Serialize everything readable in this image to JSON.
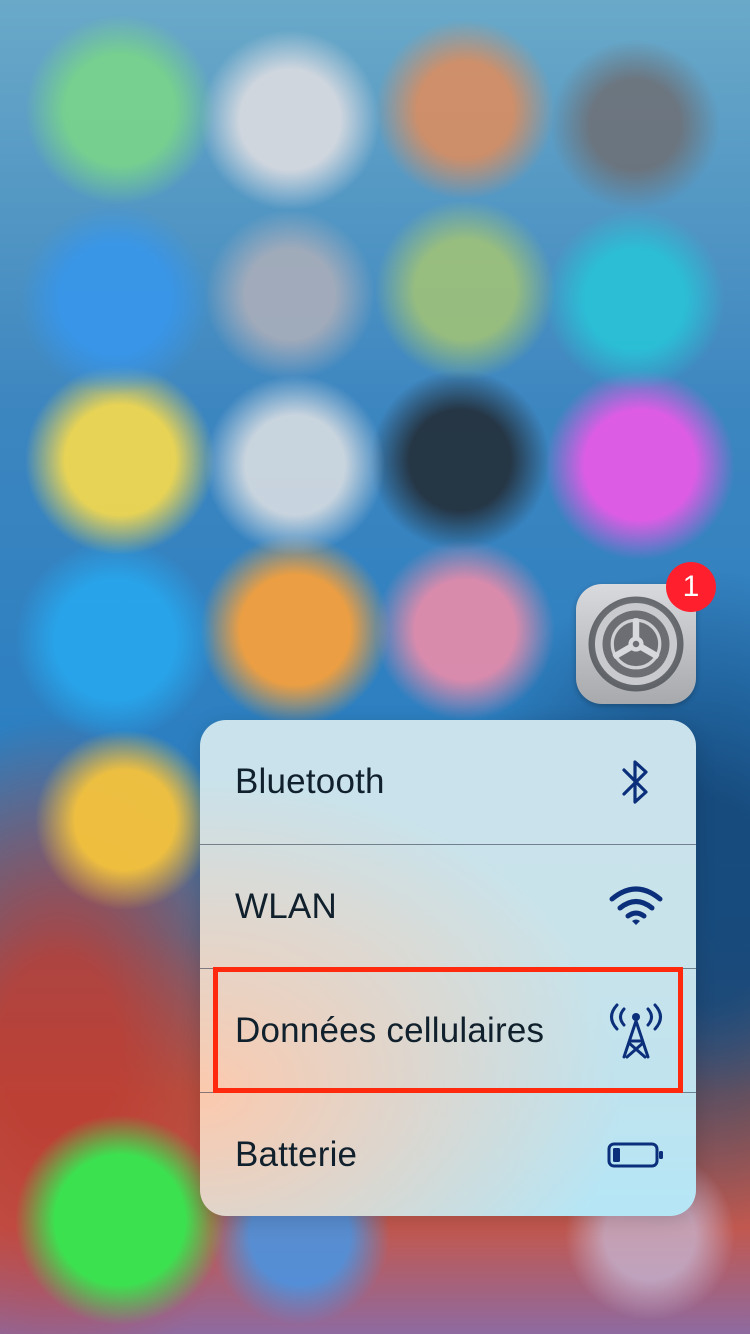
{
  "app": {
    "icon_name": "settings-gear-icon",
    "badge_count": "1"
  },
  "menu": {
    "items": [
      {
        "label": "Bluetooth",
        "icon": "bluetooth-icon"
      },
      {
        "label": "WLAN",
        "icon": "wifi-icon"
      },
      {
        "label": "Données cellulaires",
        "icon": "cellular-antenna-icon"
      },
      {
        "label": "Batterie",
        "icon": "battery-icon"
      }
    ]
  },
  "highlight": {
    "target": "Données cellulaires",
    "color": "#ff2a0d"
  },
  "colors": {
    "icon_color": "#0b2f7a",
    "badge_color": "#ff1f2d"
  }
}
